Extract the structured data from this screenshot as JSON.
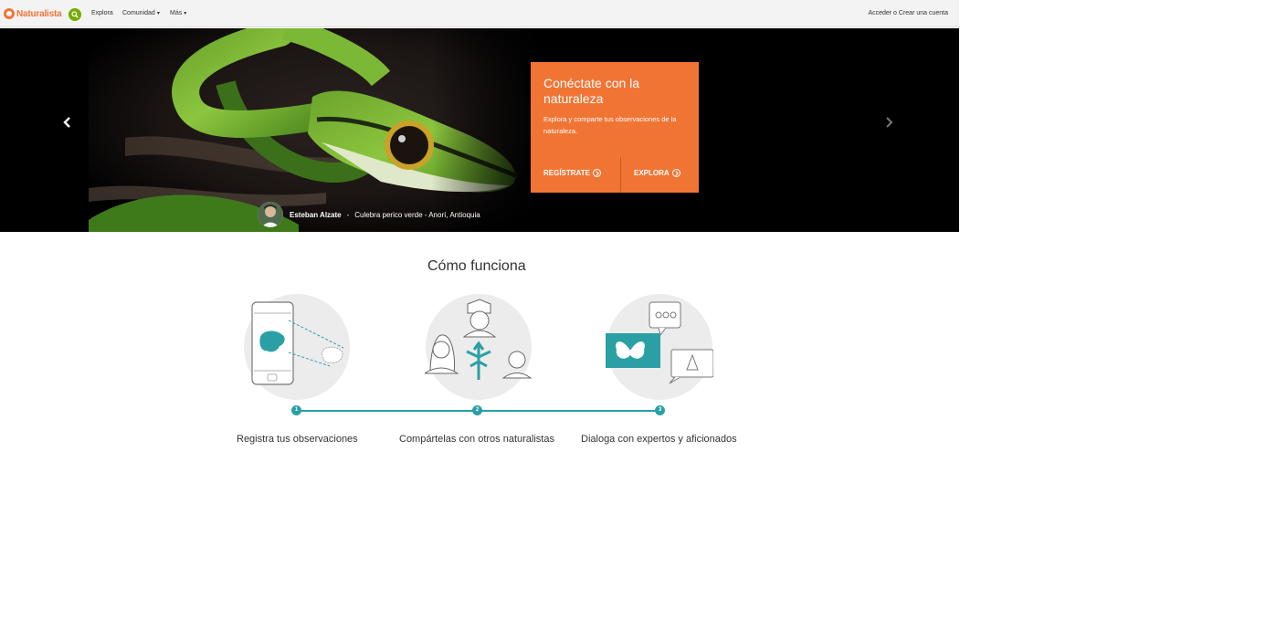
{
  "nav": {
    "logo_text": "Naturalista",
    "search_icon": "search-icon",
    "links": [
      "Explora",
      "Comunidad",
      "Más"
    ],
    "right_link": "Acceder o Crear una cuenta"
  },
  "hero": {
    "promo": {
      "title": "Conéctate con la naturaleza",
      "text": "Explora y comparte tus observaciones de la naturaleza.",
      "register_button": "REGÍSTRATE",
      "explore_button": "EXPLORA"
    },
    "credit": {
      "photographer": "Esteban Alzate",
      "caption": "Culebra perico verde - Anorí, Antioquia"
    },
    "prev_icon": "chevron-left-icon",
    "next_icon": "chevron-right-icon"
  },
  "how_it_works": {
    "title": "Cómo funciona",
    "steps": [
      {
        "number": "1",
        "label": "Registra tus observaciones"
      },
      {
        "number": "2",
        "label": "Compártelas con otros naturalistas"
      },
      {
        "number": "3",
        "label": "Dialoga con expertos y aficionados"
      }
    ]
  },
  "colors": {
    "brand_orange": "#f07535",
    "search_green": "#74ac00",
    "teal": "#2aa0a4"
  }
}
